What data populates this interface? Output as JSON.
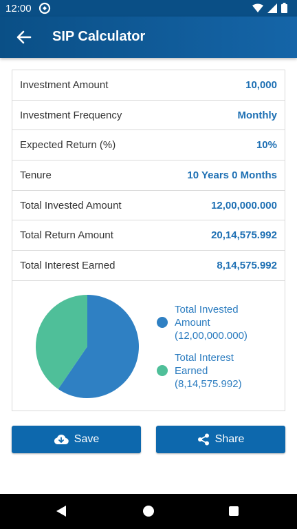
{
  "status_bar": {
    "time": "12:00",
    "icons": [
      "vpn-icon",
      "wifi-icon",
      "signal-icon",
      "battery-icon"
    ]
  },
  "app_bar": {
    "title": "SIP Calculator",
    "back_icon": "arrow-left-icon"
  },
  "summary": {
    "rows": [
      {
        "label": "Investment Amount",
        "value": "10,000"
      },
      {
        "label": "Investment Frequency",
        "value": "Monthly"
      },
      {
        "label": "Expected Return (%)",
        "value": "10%"
      },
      {
        "label": "Tenure",
        "value": "10 Years 0 Months"
      },
      {
        "label": "Total Invested Amount",
        "value": "12,00,000.000"
      },
      {
        "label": "Total Return Amount",
        "value": "20,14,575.992"
      },
      {
        "label": "Total Interest Earned",
        "value": "8,14,575.992"
      }
    ]
  },
  "legend": {
    "invested_line1": "Total Invested",
    "invested_line2": "Amount",
    "invested_value": "(12,00,000.000)",
    "interest_line1": "Total Interest",
    "interest_line2": "Earned",
    "interest_value": "(8,14,575.992)"
  },
  "chart_data": {
    "type": "pie",
    "slices": [
      {
        "label": "Total Invested Amount",
        "value": 1200000.0,
        "color": "#2f80c3"
      },
      {
        "label": "Total Interest Earned",
        "value": 814575.992,
        "color": "#4fbf99"
      }
    ]
  },
  "buttons": {
    "save_label": "Save",
    "share_label": "Share"
  },
  "colors": {
    "accent": "#0d68ad",
    "app_bar": "#0a4f86",
    "value_text": "#1d6fb3"
  }
}
